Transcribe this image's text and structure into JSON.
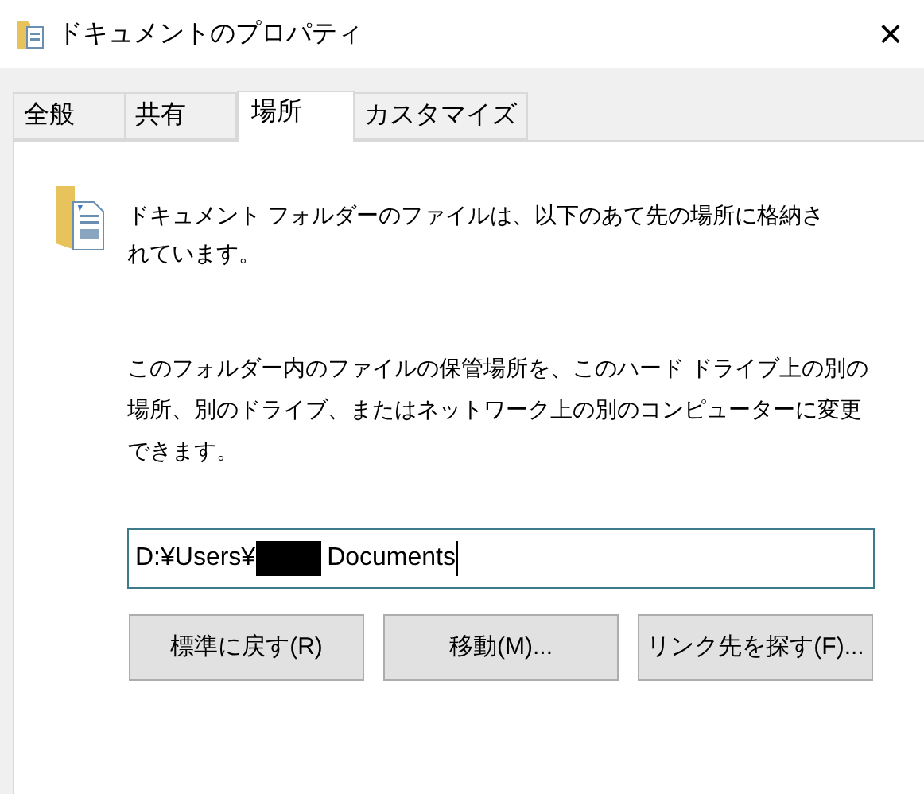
{
  "window": {
    "title": "ドキュメントのプロパティ",
    "close": "×"
  },
  "tabs": [
    {
      "label": "全般",
      "selected": false
    },
    {
      "label": "共有",
      "selected": false
    },
    {
      "label": "場所",
      "selected": true
    },
    {
      "label": "カスタマイズ",
      "selected": false
    }
  ],
  "description": {
    "lines": [
      "ドキュメント フォルダーのファイルは、以下のあて先の場所に格納さ",
      "れています。"
    ]
  },
  "explanation": {
    "lines": [
      "このフォルダー内のファイルの保管場所を、このハード ドライブ上の別の",
      "場所、別のドライブ、またはネットワーク上の別のコンピューターに変更",
      "できます。"
    ]
  },
  "path_field": {
    "value_before": "D:¥Users¥",
    "redacted": true,
    "value_after": "Documents",
    "focused": true
  },
  "buttons": [
    "標準に戻す(R)",
    "移動(M)...",
    "リンク先を探す(F)..."
  ]
}
